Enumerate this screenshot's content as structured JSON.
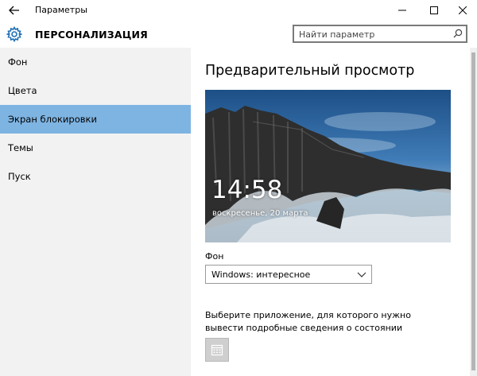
{
  "window": {
    "title": "Параметры",
    "controls": [
      "minimize-icon",
      "maximize-icon",
      "close-icon"
    ]
  },
  "header": {
    "section_title": "ПЕРСОНАЛИЗАЦИЯ",
    "icon": "gear-icon",
    "search_placeholder": "Найти параметр"
  },
  "sidebar": {
    "selected_index": 2,
    "selected_color": "#7eb4e2",
    "items": [
      {
        "label": "Фон"
      },
      {
        "label": "Цвета"
      },
      {
        "label": "Экран блокировки"
      },
      {
        "label": "Темы"
      },
      {
        "label": "Пуск"
      }
    ]
  },
  "main": {
    "preview_title": "Предварительный просмотр",
    "lock_time": "14:58",
    "lock_date": "воскресенье, 20 марта",
    "background_label": "Фон",
    "background_value": "Windows: интересное",
    "app_status_description": "Выберите приложение, для которого нужно вывести подробные сведения о состоянии",
    "app_status_icon": "calendar-icon"
  }
}
